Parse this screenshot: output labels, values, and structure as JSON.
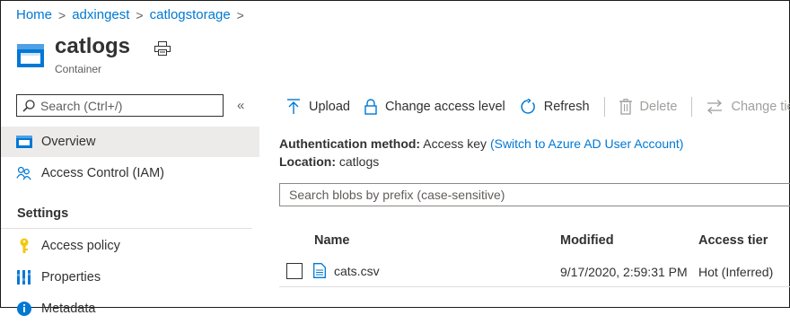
{
  "breadcrumb": [
    "Home",
    "adxingest",
    "catlogstorage"
  ],
  "header": {
    "title": "catlogs",
    "subtitle": "Container"
  },
  "sidebar": {
    "search_placeholder": "Search (Ctrl+/)",
    "collapse_glyph": "«",
    "items": [
      {
        "label": "Overview",
        "icon": "container-icon",
        "selected": true
      },
      {
        "label": "Access Control (IAM)",
        "icon": "people-icon",
        "selected": false
      }
    ],
    "section": "Settings",
    "settings_items": [
      {
        "label": "Access policy",
        "icon": "key-icon"
      },
      {
        "label": "Properties",
        "icon": "properties-icon"
      },
      {
        "label": "Metadata",
        "icon": "info-icon"
      }
    ]
  },
  "toolbar": {
    "upload": "Upload",
    "change_access": "Change access level",
    "refresh": "Refresh",
    "delete": "Delete",
    "change_tier": "Change tier"
  },
  "info": {
    "auth_label": "Authentication method:",
    "auth_value": "Access key",
    "auth_link": "(Switch to Azure AD User Account)",
    "location_label": "Location:",
    "location_value": "catlogs"
  },
  "blob_search_placeholder": "Search blobs by prefix (case-sensitive)",
  "table": {
    "headers": {
      "name": "Name",
      "modified": "Modified",
      "tier": "Access tier"
    },
    "rows": [
      {
        "name": "cats.csv",
        "modified": "9/17/2020, 2:59:31 PM",
        "tier": "Hot (Inferred)"
      }
    ]
  },
  "colors": {
    "link": "#0078d4",
    "selected_bg": "#edebe9",
    "text": "#323130"
  }
}
